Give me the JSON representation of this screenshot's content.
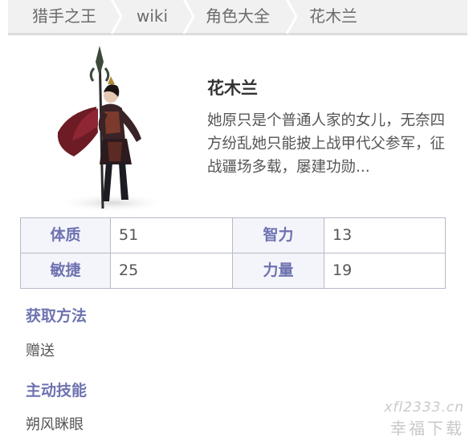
{
  "breadcrumb": {
    "items": [
      {
        "label": "猎手之王"
      },
      {
        "label": "wiki"
      },
      {
        "label": "角色大全"
      },
      {
        "label": "花木兰"
      }
    ]
  },
  "hero": {
    "name": "花木兰",
    "description": "她原只是个普通人家的女儿，无奈四方纷乱她只能披上战甲代父参军，征战疆场多载，屡建功勋..."
  },
  "stats": {
    "constitution_label": "体质",
    "constitution_value": "51",
    "intelligence_label": "智力",
    "intelligence_value": "13",
    "agility_label": "敏捷",
    "agility_value": "25",
    "strength_label": "力量",
    "strength_value": "19"
  },
  "sections": {
    "acquire_title": "获取方法",
    "acquire_text": "赠送",
    "skill_title": "主动技能",
    "skill_text": "朔风眯眼"
  },
  "watermark": {
    "line1": "xfl2333.cn",
    "line2": "幸福下载"
  },
  "colors": {
    "accent": "#6e73b0",
    "breadcrumb_bg": "#f1f1f1",
    "table_border": "#b9b9c8"
  }
}
